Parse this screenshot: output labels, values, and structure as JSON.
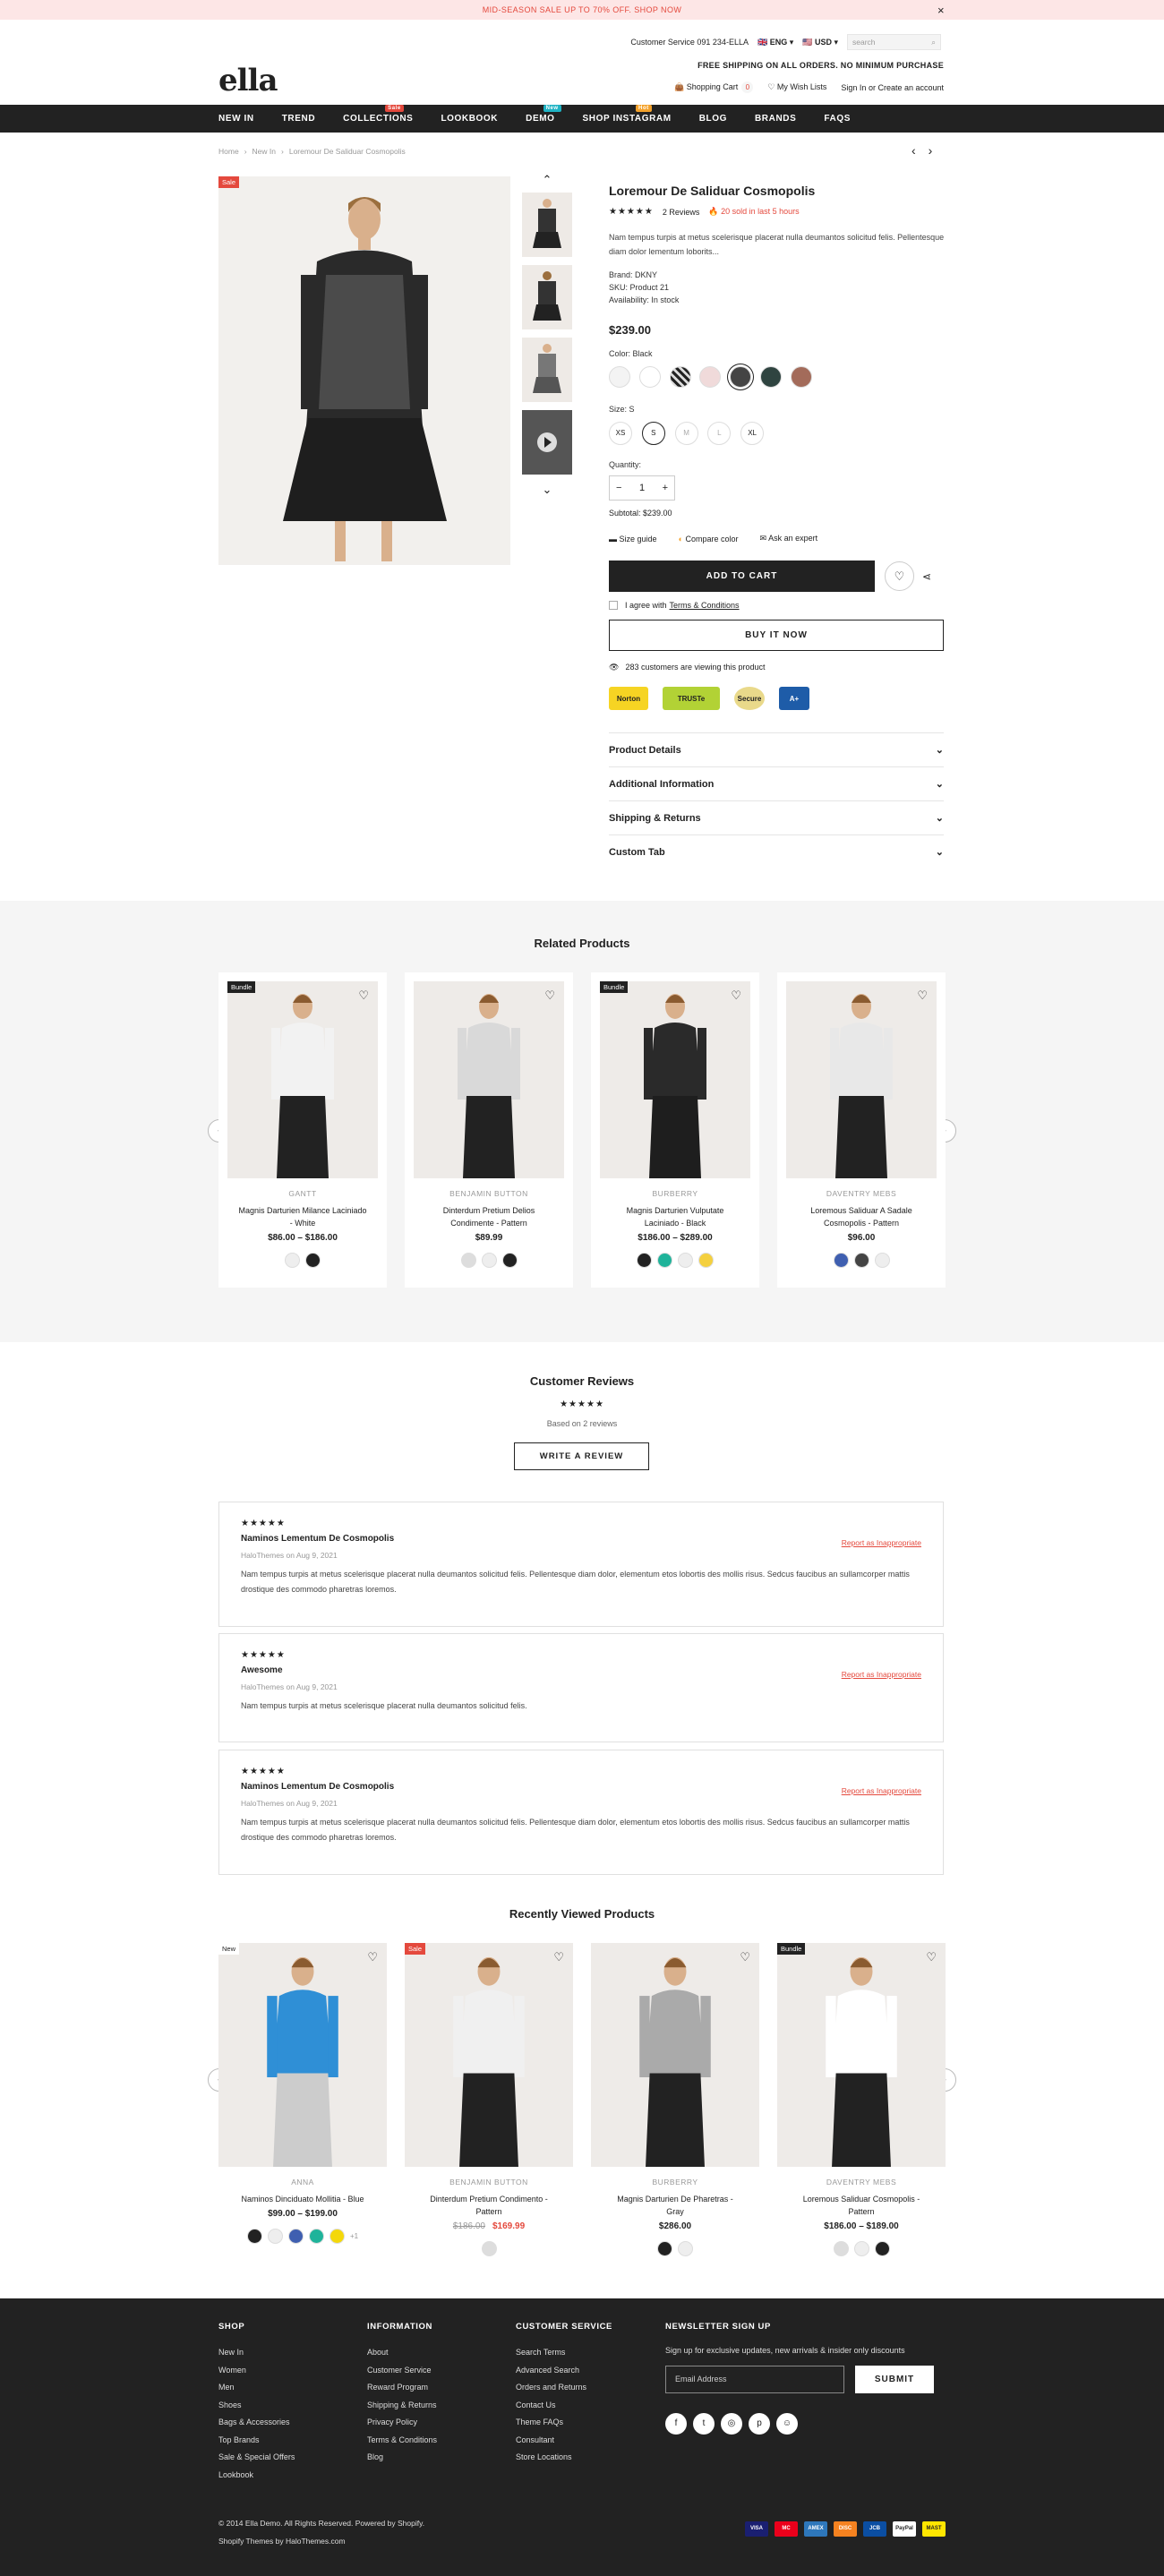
{
  "promo": {
    "text": "MID-SEASON SALE UP TO 70% OFF. SHOP NOW"
  },
  "header": {
    "logo": "ella",
    "service": "Customer Service 091 234-ELLA",
    "lang": "ENG",
    "currency": "USD",
    "search_placeholder": "search",
    "shipping": "FREE SHIPPING ON ALL ORDERS. NO MINIMUM PURCHASE",
    "cart": "Shopping Cart",
    "cart_count": "0",
    "wishlist": "My Wish Lists",
    "account": "Sign In or Create an account"
  },
  "nav": [
    {
      "label": "NEW IN"
    },
    {
      "label": "TREND"
    },
    {
      "label": "COLLECTIONS",
      "tag": "Sale",
      "tagcolor": "#e4493d"
    },
    {
      "label": "LOOKBOOK"
    },
    {
      "label": "DEMO",
      "tag": "New",
      "tagcolor": "#1fb3c4"
    },
    {
      "label": "SHOP INSTAGRAM",
      "tag": "Hot",
      "tagcolor": "#f4a22b"
    },
    {
      "label": "BLOG"
    },
    {
      "label": "BRANDS"
    },
    {
      "label": "FAQS"
    }
  ],
  "breadcrumb": [
    "Home",
    "New In",
    "Loremour De Saliduar Cosmopolis"
  ],
  "product": {
    "sale_badge": "Sale",
    "title": "Loremour De Saliduar Cosmopolis",
    "stars": "★★★★★",
    "reviews": "2 Reviews",
    "sold": "20 sold in last 5 hours",
    "desc": "Nam tempus turpis at metus scelerisque placerat nulla deumantos solicitud felis. Pellentesque diam dolor lementum loborits...",
    "brand": "Brand: DKNY",
    "sku": "SKU: Product 21",
    "availability": "Availability: In stock",
    "price": "$239.00",
    "color_label": "Color: Black",
    "size_label": "Size: S",
    "sizes": [
      "XS",
      "S",
      "M",
      "L",
      "XL"
    ],
    "qty_label": "Quantity:",
    "qty": "1",
    "subtotal": "Subtotal: $239.00",
    "size_guide": "Size guide",
    "compare": "Compare color",
    "ask": "Ask an expert",
    "add_to_cart": "ADD TO CART",
    "agree": "I agree with",
    "terms": "Terms & Conditions",
    "buy_now": "BUY IT NOW",
    "viewing": "283 customers are viewing this product",
    "trust": [
      "Norton",
      "TRUSTe",
      "Secure",
      "A+"
    ]
  },
  "accordion": [
    "Product Details",
    "Additional Information",
    "Shipping & Returns",
    "Custom Tab"
  ],
  "related": {
    "title": "Related Products",
    "items": [
      {
        "badge": "Bundle",
        "brand": "GANTT",
        "name": "Magnis Darturien Milance Laciniado - White",
        "price": "$86.00 – $186.00"
      },
      {
        "badge": "",
        "brand": "BENJAMIN BUTTON",
        "name": "Dinterdum Pretium Delios Condimente - Pattern",
        "price": "$89.99"
      },
      {
        "badge": "Bundle",
        "brand": "BURBERRY",
        "name": "Magnis Darturien Vulputate Laciniado - Black",
        "price": "$186.00 – $289.00"
      },
      {
        "badge": "",
        "brand": "DAVENTRY MEBS",
        "name": "Loremous Saliduar A Sadale Cosmopolis - Pattern",
        "price": "$96.00"
      }
    ]
  },
  "reviews": {
    "title": "Customer Reviews",
    "stars": "★★★★★",
    "based": "Based on 2 reviews",
    "write": "WRITE A REVIEW",
    "report": "Report as Inappropriate",
    "items": [
      {
        "stars": "★★★★★",
        "title": "Naminos Lementum De Cosmopolis",
        "date": "HaloThemes on Aug 9, 2021",
        "body": "Nam tempus turpis at metus scelerisque placerat nulla deumantos solicitud felis. Pellentesque diam dolor, elementum etos lobortis des mollis risus. Sedcus faucibus an sullamcorper mattis drostique des commodo pharetras loremos."
      },
      {
        "stars": "★★★★★",
        "title": "Awesome",
        "date": "HaloThemes on Aug 9, 2021",
        "body": "Nam tempus turpis at metus scelerisque placerat nulla deumantos solicitud felis."
      },
      {
        "stars": "★★★★★",
        "title": "Naminos Lementum De Cosmopolis",
        "date": "HaloThemes on Aug 9, 2021",
        "body": "Nam tempus turpis at metus scelerisque placerat nulla deumantos solicitud felis. Pellentesque diam dolor, elementum etos lobortis des mollis risus. Sedcus faucibus an sullamcorper mattis drostique des commodo pharetras loremos."
      }
    ]
  },
  "recent": {
    "title": "Recently Viewed Products",
    "items": [
      {
        "badge": "New",
        "brand": "ANNA",
        "name": "Naminos Dinciduato Mollitia - Blue",
        "price": "$99.00 – $199.00",
        "old": ""
      },
      {
        "badge": "Sale",
        "brand": "BENJAMIN BUTTON",
        "name": "Dinterdum Pretium Condimento - Pattern",
        "price": "$169.99",
        "old": "$186.00"
      },
      {
        "badge": "",
        "brand": "BURBERRY",
        "name": "Magnis Darturien De Pharetras - Gray",
        "price": "$286.00",
        "old": ""
      },
      {
        "badge": "Bundle",
        "brand": "DAVENTRY MEBS",
        "name": "Loremous Saliduar Cosmopolis - Pattern",
        "price": "$186.00 – $189.00",
        "old": ""
      }
    ],
    "more": "+1"
  },
  "footer": {
    "shop": {
      "title": "SHOP",
      "links": [
        "New In",
        "Women",
        "Men",
        "Shoes",
        "Bags & Accessories",
        "Top Brands",
        "Sale & Special Offers",
        "Lookbook"
      ]
    },
    "info": {
      "title": "INFORMATION",
      "links": [
        "About",
        "Customer Service",
        "Reward Program",
        "Shipping & Returns",
        "Privacy Policy",
        "Terms & Conditions",
        "Blog"
      ]
    },
    "cs": {
      "title": "CUSTOMER SERVICE",
      "links": [
        "Search Terms",
        "Advanced Search",
        "Orders and Returns",
        "Contact Us",
        "Theme FAQs",
        "Consultant",
        "Store Locations"
      ]
    },
    "news": {
      "title": "NEWSLETTER SIGN UP",
      "text": "Sign up for exclusive updates, new arrivals & insider only discounts",
      "placeholder": "Email Address",
      "submit": "SUBMIT"
    },
    "copy": "© 2014 Ella Demo. All Rights Reserved. Powered by Shopify.",
    "themes": "Shopify Themes by HaloThemes.com",
    "payments": [
      "VISA",
      "MC",
      "AMEX",
      "DISC",
      "JCB",
      "PayPal",
      "MAST"
    ]
  },
  "colors": {
    "accent": "#e4493d",
    "dark": "#222222"
  }
}
